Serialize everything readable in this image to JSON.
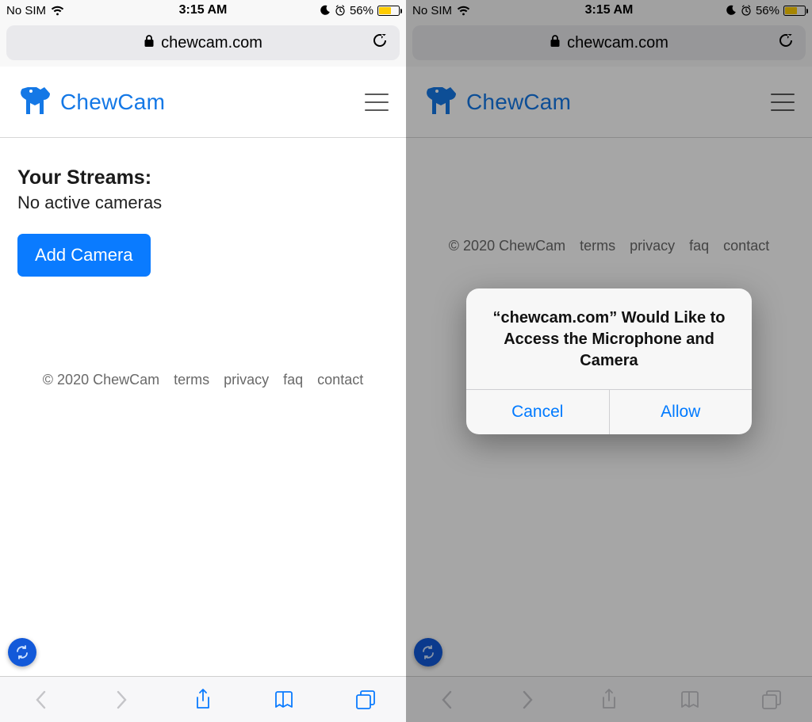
{
  "statusbar": {
    "carrier": "No SIM",
    "time": "3:15 AM",
    "battery_pct": "56%"
  },
  "urlbar": {
    "domain": "chewcam.com"
  },
  "app": {
    "brand": "ChewCam"
  },
  "left": {
    "streams_title": "Your Streams:",
    "streams_empty": "No active cameras",
    "add_button": "Add Camera"
  },
  "footer": {
    "copyright": "© 2020 ChewCam",
    "links": [
      "terms",
      "privacy",
      "faq",
      "contact"
    ]
  },
  "alert": {
    "message": "“chewcam.com” Would Like to Access the Microphone and Camera",
    "cancel": "Cancel",
    "allow": "Allow"
  }
}
